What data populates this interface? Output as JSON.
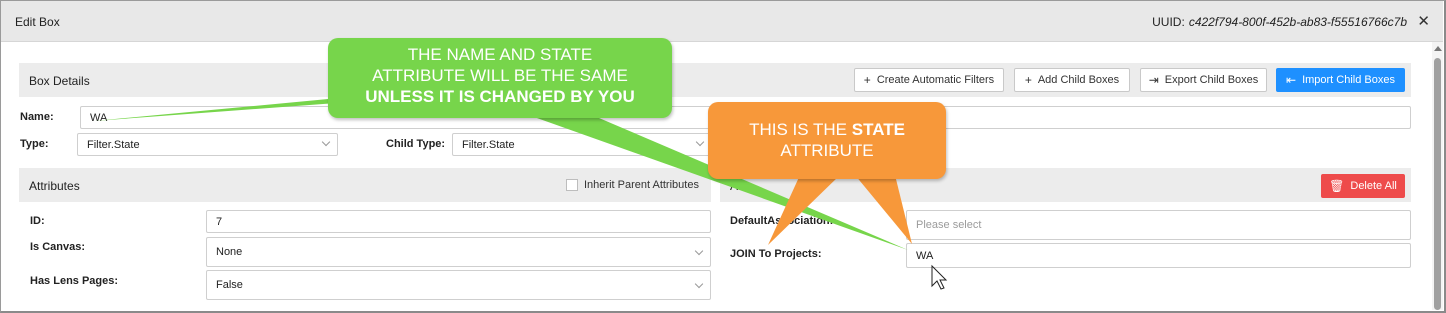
{
  "dialog": {
    "title": "Edit Box",
    "uuid_label": "UUID:",
    "uuid_value": "c422f794-800f-452b-ab83-f55516766c7b",
    "close_symbol": "✕"
  },
  "box_details": {
    "title": "Box Details",
    "buttons": {
      "create_filters": "Create Automatic Filters",
      "add_child": "Add Child Boxes",
      "export_child": "Export Child Boxes",
      "import_child": "Import Child Boxes"
    },
    "name_label": "Name:",
    "name_value": "WA",
    "type_label": "Type:",
    "type_value": "Filter.State",
    "child_type_label": "Child Type:",
    "child_type_value": "Filter.State"
  },
  "attributes": {
    "title": "Attributes",
    "inherit_label": "Inherit Parent Attributes",
    "inherit_checked": false,
    "rows": {
      "id_label": "ID:",
      "id_value": "7",
      "is_canvas_label": "Is Canvas:",
      "is_canvas_value": "None",
      "has_lens_label": "Has Lens Pages:",
      "has_lens_value": "False"
    }
  },
  "associations": {
    "title_fragment": "A",
    "delete_all": "Delete All",
    "default_label": "DefaultAssociation:",
    "default_placeholder": "Please select",
    "join_label": "JOIN To Projects:",
    "join_value": "WA"
  },
  "callouts": {
    "green": {
      "line1": "THE NAME AND STATE",
      "line2": "ATTRIBUTE WILL BE THE SAME",
      "line3": "UNLESS IT IS CHANGED BY YOU",
      "color": "#77d54b"
    },
    "orange": {
      "line1_plain": "THIS IS THE",
      "line1_bold": "STATE",
      "line2": "ATTRIBUTE",
      "color": "#f7983a"
    }
  },
  "icons": {
    "plus": "+",
    "export": "⇥",
    "import": "⇤",
    "trash": "🗑",
    "close": "✕"
  },
  "colors": {
    "primary": "#1e90ff",
    "danger": "#ee4b4b",
    "header_bg": "#e8e8e8",
    "section_bg": "#ececec"
  }
}
